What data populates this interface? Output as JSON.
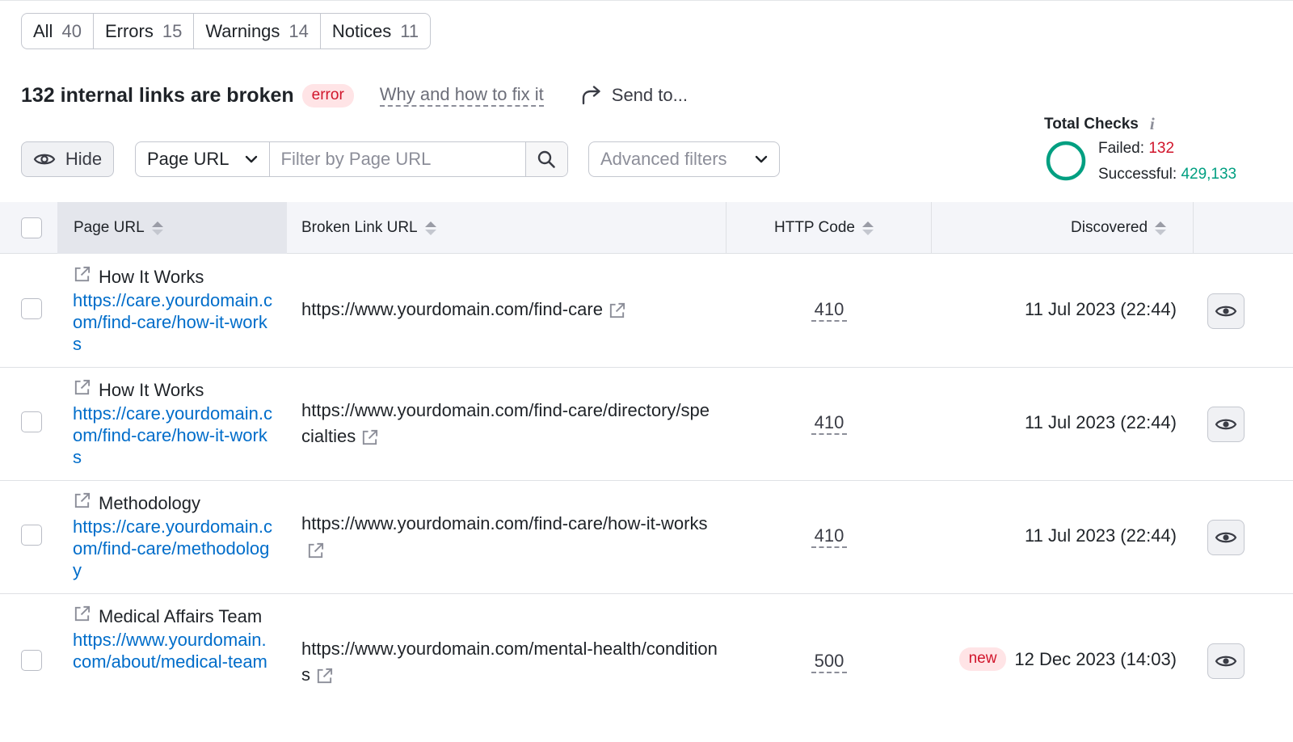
{
  "tabs": [
    {
      "label": "All",
      "count": "40"
    },
    {
      "label": "Errors",
      "count": "15"
    },
    {
      "label": "Warnings",
      "count": "14"
    },
    {
      "label": "Notices",
      "count": "11"
    }
  ],
  "issue": {
    "title": "132 internal links are broken",
    "badge": "error",
    "fix_link": "Why and how to fix it",
    "send_to": "Send to..."
  },
  "filters": {
    "hide_label": "Hide",
    "column_select": "Page URL",
    "search_placeholder": "Filter by Page URL",
    "advanced_label": "Advanced filters"
  },
  "total_checks": {
    "title": "Total Checks",
    "failed_label": "Failed:",
    "failed_value": "132",
    "successful_label": "Successful:",
    "successful_value": "429,133",
    "failed_color": "#d1152b",
    "success_color": "#009f81"
  },
  "table": {
    "columns": {
      "page_url": "Page URL",
      "broken_link_url": "Broken Link URL",
      "http_code": "HTTP Code",
      "discovered": "Discovered"
    },
    "rows": [
      {
        "page_title": "How It Works",
        "page_url": "https://care.yourdomain.com/find-care/how-it-works",
        "broken_url": "https://www.yourdomain.com/find-care",
        "http_code": "410",
        "badge": "",
        "discovered": "11 Jul 2023 (22:44)"
      },
      {
        "page_title": "How It Works",
        "page_url": "https://care.yourdomain.com/find-care/how-it-works",
        "broken_url": "https://www.yourdomain.com/find-care/directory/specialties",
        "http_code": "410",
        "badge": "",
        "discovered": "11 Jul 2023 (22:44)"
      },
      {
        "page_title": "Methodology",
        "page_url": "https://care.yourdomain.com/find-care/methodology",
        "broken_url": "https://www.yourdomain.com/find-care/how-it-works",
        "http_code": "410",
        "badge": "",
        "discovered": "11 Jul 2023 (22:44)"
      },
      {
        "page_title": "Medical Affairs Team",
        "page_url": "https://www.yourdomain.com/about/medical-team",
        "broken_url": "https://www.yourdomain.com/mental-health/conditions",
        "http_code": "500",
        "badge": "new",
        "discovered": "12 Dec 2023 (14:03)"
      }
    ]
  }
}
